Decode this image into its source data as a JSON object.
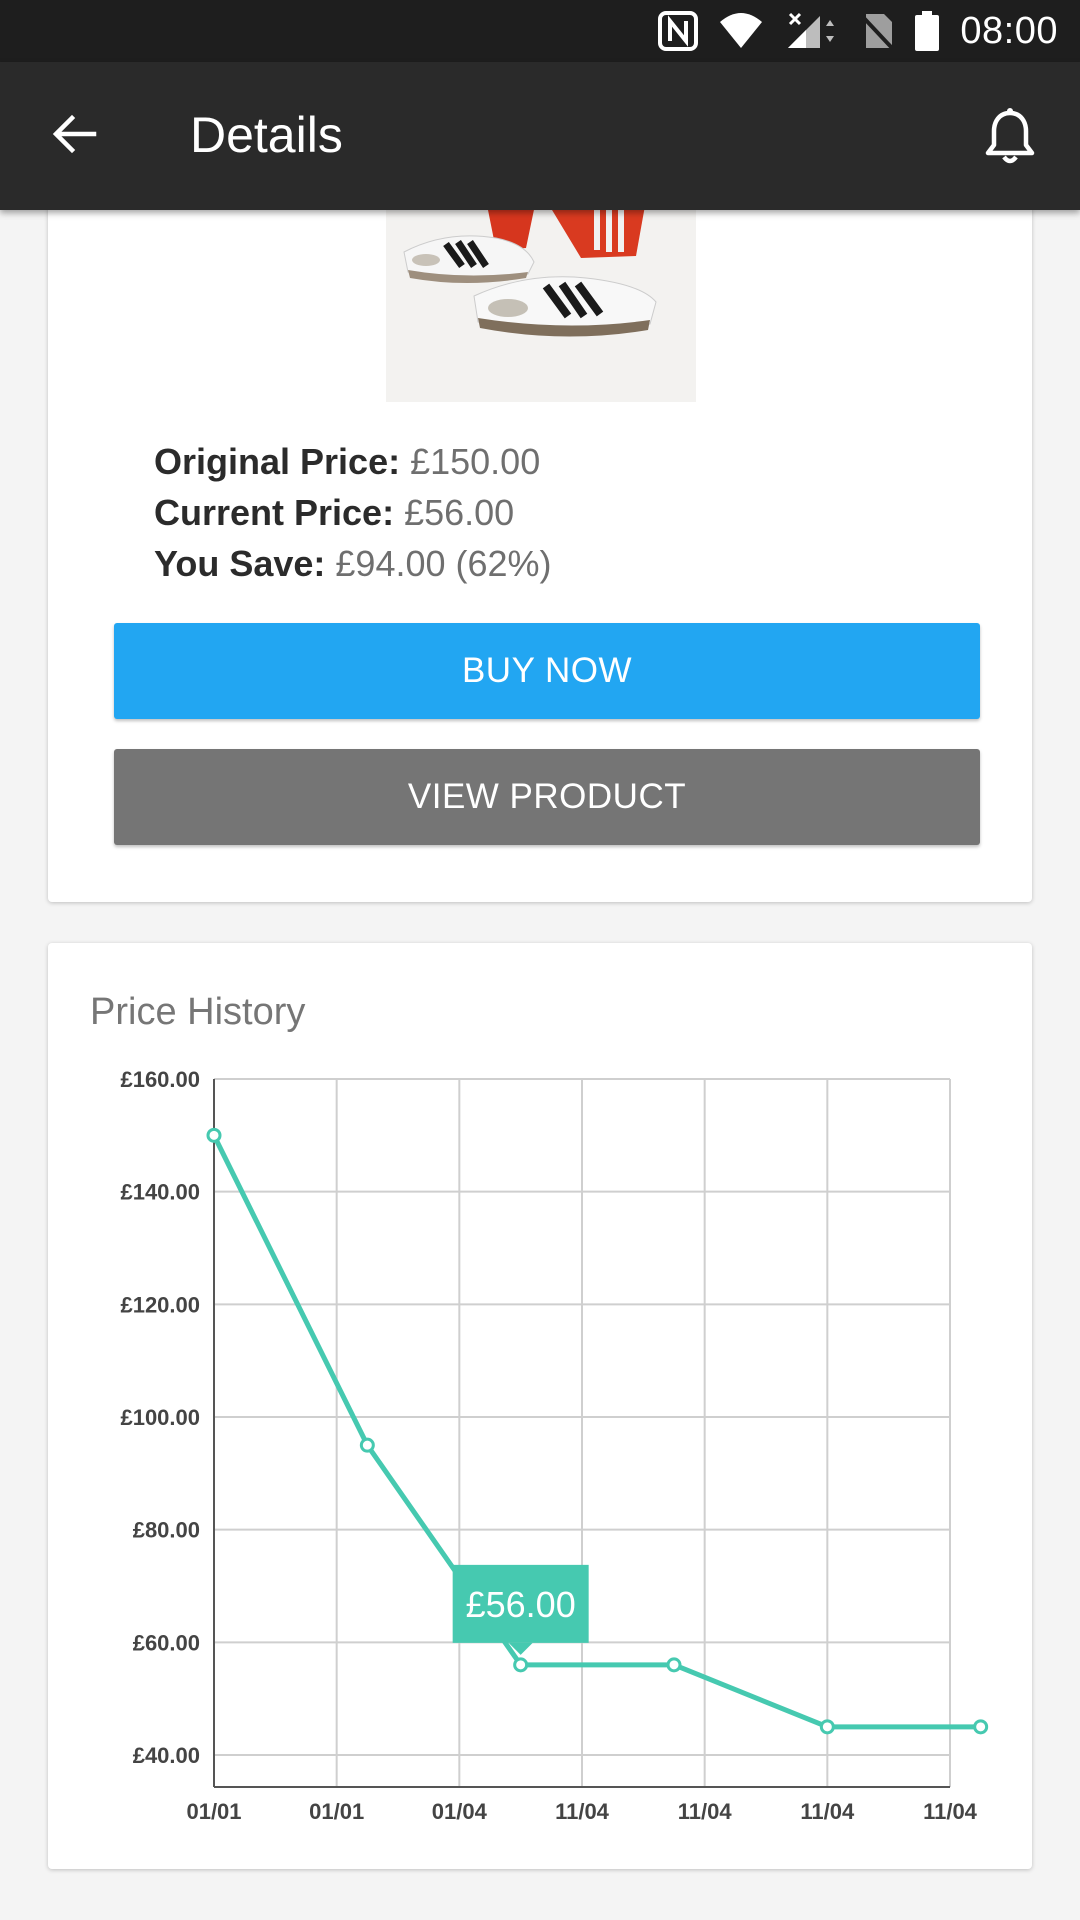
{
  "status_bar": {
    "time": "08:00",
    "icons": [
      "nfc-icon",
      "wifi-icon",
      "signal-icon",
      "no-sim-icon",
      "battery-icon"
    ]
  },
  "app_bar": {
    "title": "Details",
    "back_icon": "arrow-back-icon",
    "action_icon": "bell-icon"
  },
  "product": {
    "image": "sneakers-photo",
    "original_label": "Original Price:",
    "original_value": "£150.00",
    "current_label": "Current Price:",
    "current_value": "£56.00",
    "save_label": "You Save:",
    "save_value": "£94.00 (62%)",
    "buy_label": "BUY NOW",
    "view_label": "VIEW PRODUCT"
  },
  "colors": {
    "buy_button": "#22a6f2",
    "view_button": "#757575",
    "line": "#46c9b0",
    "app_bar": "#2a2a2a"
  },
  "price_history": {
    "title": "Price History"
  },
  "chart_data": {
    "type": "line",
    "title": "Price History",
    "grid": true,
    "legend": "none",
    "x_ticks": [
      "01/01",
      "01/01",
      "01/04",
      "11/04",
      "11/04",
      "11/04",
      "11/04"
    ],
    "y_ticks": [
      "£40.00",
      "£60.00",
      "£80.00",
      "£100.00",
      "£120.00",
      "£140.00",
      "£160.00"
    ],
    "ylim": [
      40,
      160
    ],
    "x": [
      0,
      1.25,
      2.5,
      3.75,
      5,
      6.25
    ],
    "values": [
      150,
      95,
      56,
      56,
      45,
      45
    ],
    "tooltip": {
      "label": "£56.00",
      "point_index": 2
    }
  }
}
